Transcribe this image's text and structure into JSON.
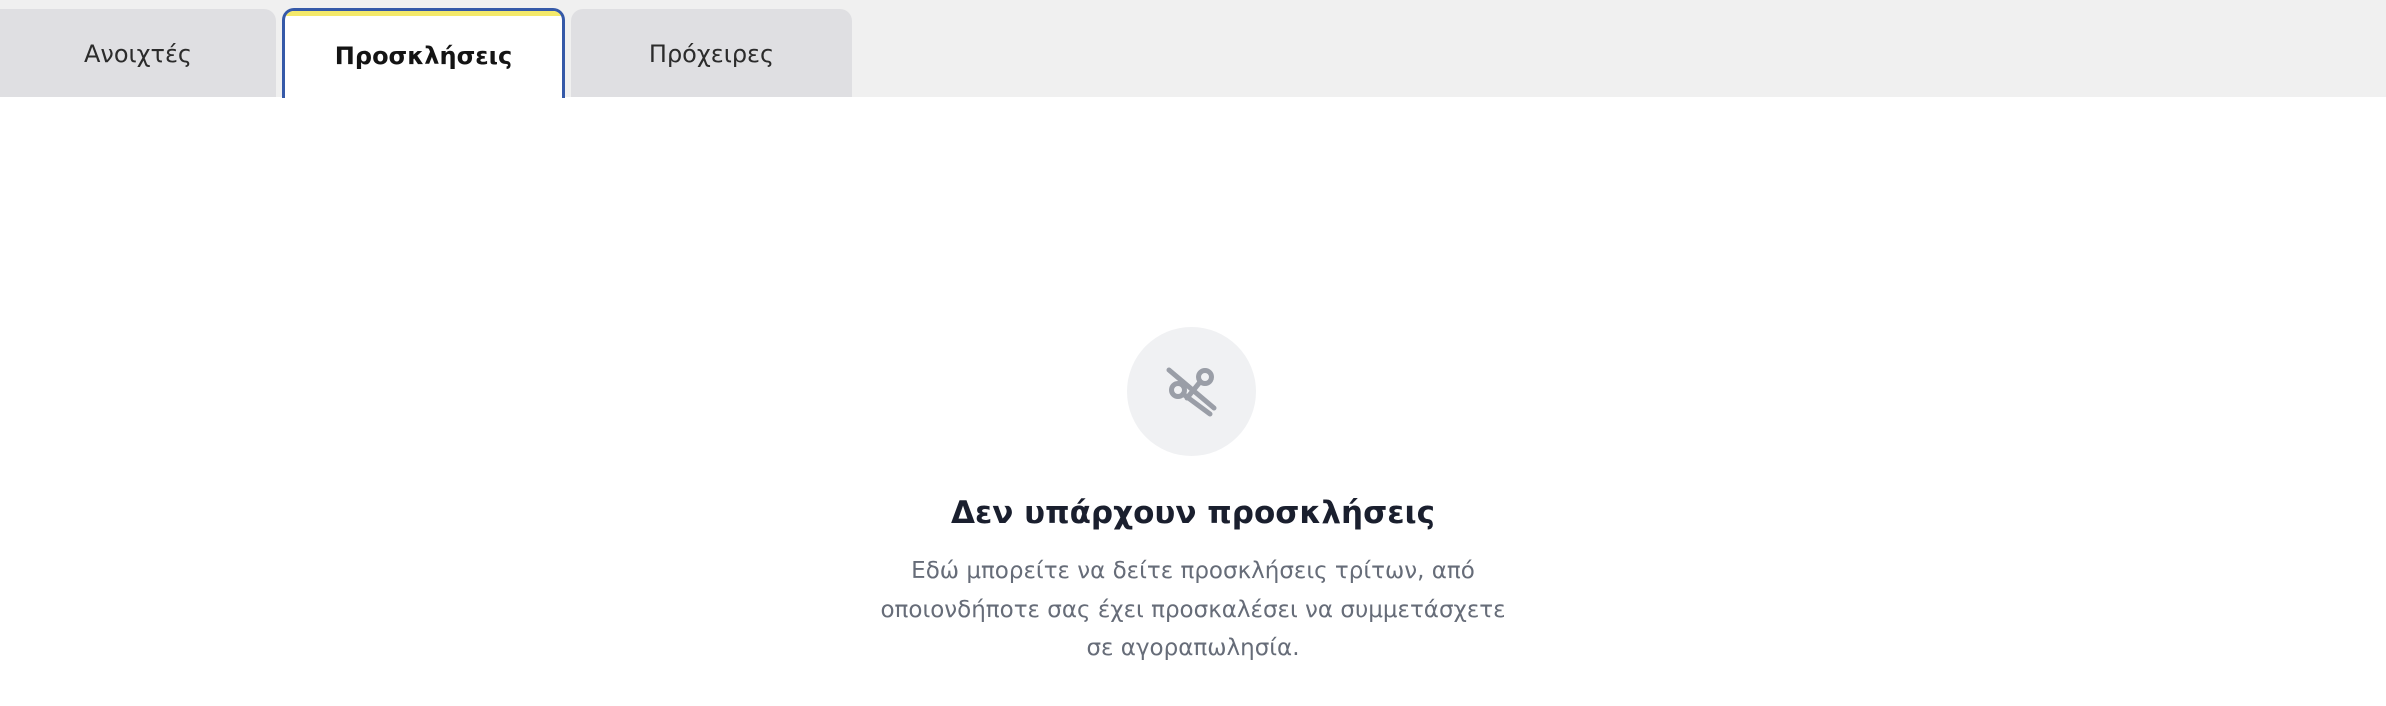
{
  "tabs": [
    {
      "label": "Ανοιχτές",
      "active": false
    },
    {
      "label": "Προσκλήσεις",
      "active": true
    },
    {
      "label": "Πρόχειρες",
      "active": false
    }
  ],
  "empty_state": {
    "icon": "scissors-off-icon",
    "title": "Δεν υπάρχουν προσκλήσεις",
    "description": "Εδώ μπορείτε να δείτε προσκλήσεις τρίτων, από οποιονδήποτε σας έχει προσκαλέσει να συμμετάσχετε σε αγοραπωλησία."
  },
  "colors": {
    "active_tab_border": "#3559a8",
    "active_tab_accent": "#f4e96a",
    "tabbar_background": "#f0f0f0",
    "inactive_tab": "#dfdfe2"
  }
}
